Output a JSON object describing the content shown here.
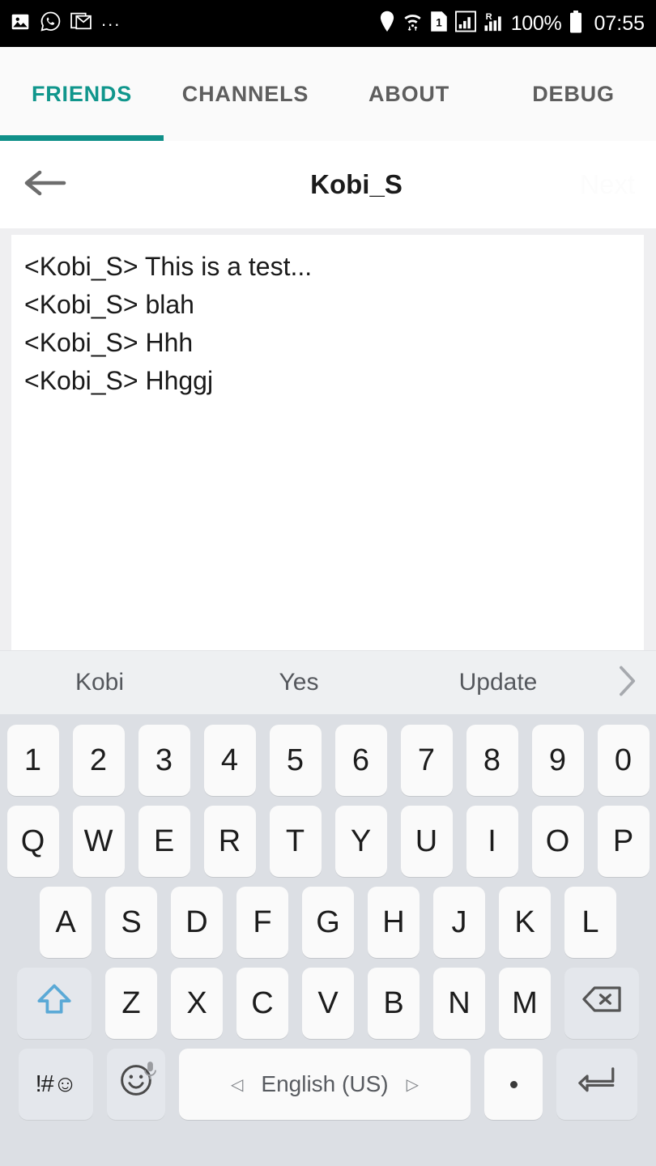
{
  "status_bar": {
    "left_icons": [
      "photo-icon",
      "whatsapp-icon",
      "gmail-icon",
      "overflow-ellipsis-icon"
    ],
    "ellipsis": "...",
    "right_icons": [
      "location-pin-icon",
      "wifi-icon",
      "sim-1-icon",
      "signal-bars-icon",
      "roaming-signal-icon",
      "battery-icon"
    ],
    "sim_label": "1",
    "roaming_label": "R",
    "battery_percent": "100%",
    "time": "07:55"
  },
  "tabs": {
    "items": [
      {
        "label": "FRIENDS",
        "active": true
      },
      {
        "label": "CHANNELS",
        "active": false
      },
      {
        "label": "ABOUT",
        "active": false
      },
      {
        "label": "DEBUG",
        "active": false
      }
    ],
    "active_color": "#10968c",
    "inactive_color": "#5e5e5e"
  },
  "header": {
    "back_icon": "arrow-left-icon",
    "title": "Kobi_S",
    "next_label": "Next"
  },
  "chat_log": {
    "lines": [
      "<Kobi_S> This is a test...",
      "<Kobi_S> blah",
      "<Kobi_S> Hhh",
      "<Kobi_S> Hhggj"
    ]
  },
  "suggestions": {
    "items": [
      "Kobi",
      "Yes",
      "Update"
    ],
    "more_icon": "chevron-right-icon"
  },
  "keyboard": {
    "row_numbers": [
      "1",
      "2",
      "3",
      "4",
      "5",
      "6",
      "7",
      "8",
      "9",
      "0"
    ],
    "row_q": [
      "Q",
      "W",
      "E",
      "R",
      "T",
      "Y",
      "U",
      "I",
      "O",
      "P"
    ],
    "row_a": [
      "A",
      "S",
      "D",
      "F",
      "G",
      "H",
      "J",
      "K",
      "L"
    ],
    "row_z": [
      "Z",
      "X",
      "C",
      "V",
      "B",
      "N",
      "M"
    ],
    "shift_icon": "shift-arrow-icon",
    "backspace_icon": "backspace-icon",
    "symbols_label": "!#☺",
    "emoji_icon": "emoji-smiley-icon",
    "mic_icon": "microphone-icon",
    "space_label": "English (US)",
    "space_left_arrow": "◁",
    "space_right_arrow": "▷",
    "period_label": ".",
    "enter_icon": "enter-return-icon",
    "shift_color": "#5aa9d6",
    "key_bg": "#fafafa",
    "fn_key_bg": "#e4e7ec",
    "keyboard_bg": "#dcdfe4"
  }
}
